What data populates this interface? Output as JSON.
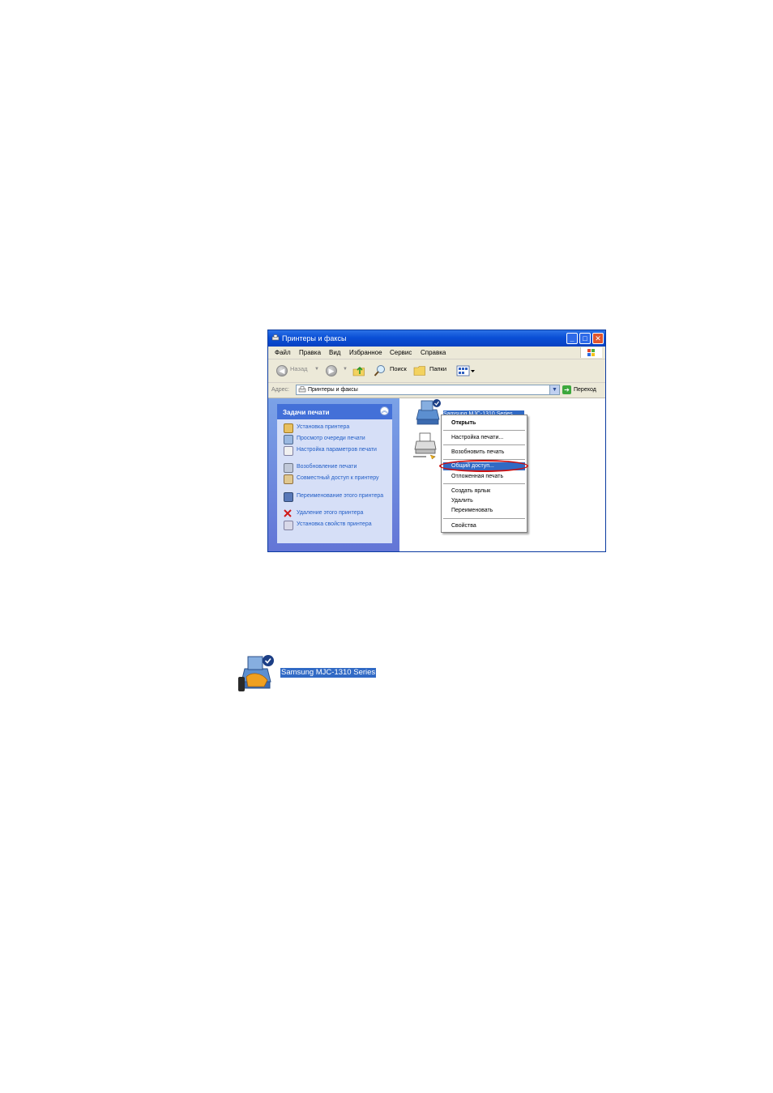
{
  "window": {
    "title": "Принтеры и факсы",
    "menu": [
      "Файл",
      "Правка",
      "Вид",
      "Избранное",
      "Сервис",
      "Справка"
    ],
    "toolbar": {
      "back": "Назад",
      "search": "Поиск",
      "folders": "Папки"
    },
    "address": {
      "label": "Адрес:",
      "value": "Принтеры и факсы",
      "go": "Переход"
    }
  },
  "sidebar": {
    "header": "Задачи печати",
    "tasks": [
      "Установка принтера",
      "Просмотр очереди печати",
      "Настройка параметров печати",
      "Возобновление печати",
      "Совместный доступ к принтеру",
      "Переименование этого принтера",
      "Удаление этого принтера",
      "Установка свойств принтера"
    ]
  },
  "context_menu": {
    "items": [
      "Открыть",
      "Настройка печати...",
      "Возобновить печать",
      "Общий доступ...",
      "Отложенная печать",
      "Создать ярлык",
      "Удалить",
      "Переименовать",
      "Свойства"
    ]
  },
  "printer_label": "Samsung MJC-1310 Series",
  "colors": {
    "selection": "#316ac5",
    "highlight_oval": "#cc1010",
    "titlebar": "#0a4fd6"
  }
}
